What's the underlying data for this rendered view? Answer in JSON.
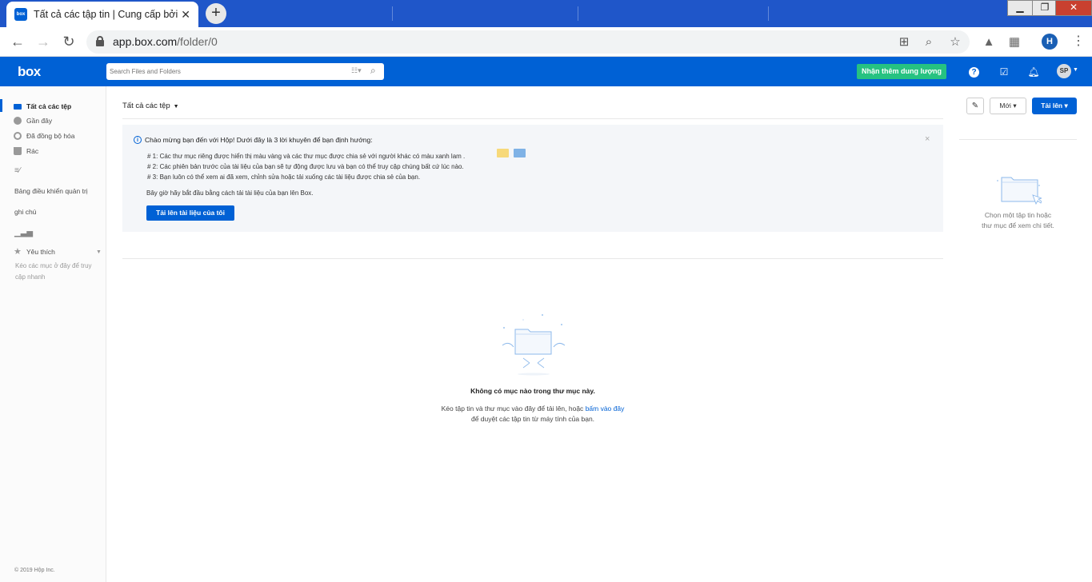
{
  "browser": {
    "active_tab_title": "Tất cả các tập tin | Cung cấp bởi Box",
    "favicon_text": "box",
    "tab_close": "✕",
    "new_tab": "+",
    "url_host": "app.box.com",
    "url_path": "/folder/0",
    "profile_initial": "H",
    "window_controls": {
      "minimize": "▁",
      "maximize": "❐",
      "close": "✕"
    }
  },
  "header": {
    "logo": "box",
    "search_placeholder": "Search Files and Folders",
    "upgrade_label": "Nhận thêm dung lượng",
    "avatar_initials": "SP"
  },
  "sidebar": {
    "items": [
      {
        "label": "Tất cả các tệp"
      },
      {
        "label": "Gần đây"
      },
      {
        "label": "Đã đồng bộ hóa"
      },
      {
        "label": "Rác"
      }
    ],
    "admin_console": "Bảng điều khiển quản trị",
    "notes": "ghi chú",
    "favorites_label": "Yêu thích",
    "favorites_hint": "Kéo các mục ở đây để truy cập nhanh",
    "copyright": "© 2019 Hộp Inc."
  },
  "main": {
    "breadcrumb": "Tất cả các tệp",
    "new_button": "Mới",
    "upload_button": "Tải lên",
    "banner": {
      "title": "Chào mừng bạn đến với Hộp! Dưới đây là 3 lời khuyên để bạn định hướng:",
      "tips": [
        "# 1: Các thư mục riêng được hiển thị màu vàng và các thư mục được chia sẻ với người khác có màu xanh lam .",
        "# 2: Các phiên bản trước của tài liệu của bạn sẽ tự động được lưu và bạn có thể truy cập chúng bất cứ lúc nào.",
        "# 3: Bạn luôn có thể xem ai đã xem, chỉnh sửa hoặc tải xuống các tài liệu được chia sẻ của bạn."
      ],
      "prompt": "Bây giờ hãy bắt đầu bằng cách tải tài liệu của bạn lên Box.",
      "cta": "Tải lên tài liệu của tôi",
      "close": "×"
    },
    "empty": {
      "title": "Không có mục nào trong thư mục này.",
      "desc_before_link": "Kéo tập tin và thư mục vào đây để tải lên, hoặc ",
      "link": "bấm vào đây",
      "desc_line2": "để duyệt các tập tin từ máy tính của bạn."
    }
  },
  "details_panel": {
    "line1": "Chọn một tập tin hoặc",
    "line2": "thư mục để xem chi tiết."
  },
  "colors": {
    "brand": "#0061d5",
    "upgrade": "#26c281",
    "tabstrip": "#1f56c9"
  }
}
